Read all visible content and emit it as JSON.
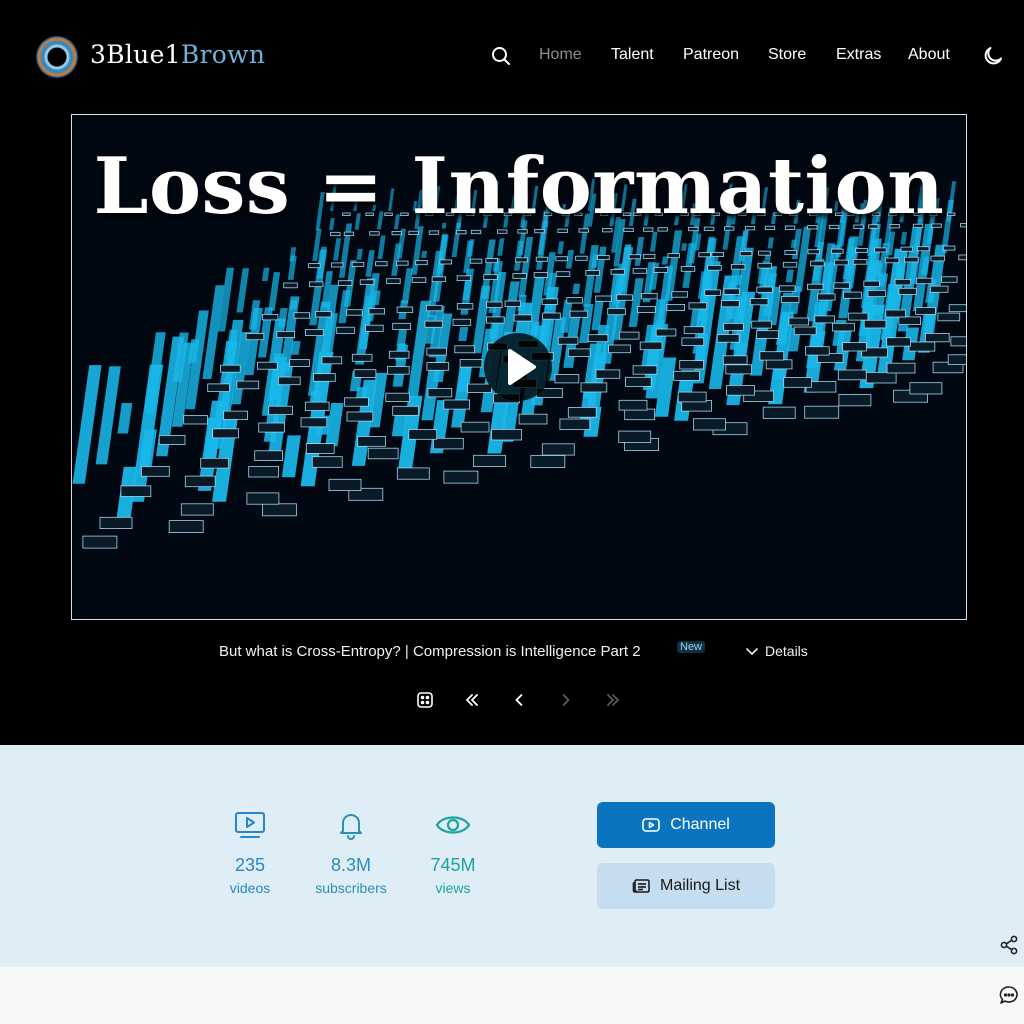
{
  "brand": {
    "name_part1": "3Blue1",
    "name_part2": "Brown"
  },
  "nav": {
    "search_icon": "search-icon",
    "items": [
      "Home",
      "Talent",
      "Patreon",
      "Store",
      "Extras",
      "About"
    ],
    "active": "Home",
    "theme_icon": "moon-icon"
  },
  "video": {
    "thumbnail_title": "Loss = Information",
    "title": "But what is Cross-Entropy? | Compression is Intelligence Part 2",
    "badge": "New",
    "details_label": "Details"
  },
  "controls": [
    "shuffle-icon",
    "first-icon",
    "previous-icon",
    "next-icon",
    "last-icon"
  ],
  "stats": [
    {
      "value": "235",
      "label": "videos",
      "icon": "video-icon",
      "color": "#2a86c8"
    },
    {
      "value": "8.3M",
      "label": "subscribers",
      "icon": "bell-icon",
      "color": "#2a8fb8"
    },
    {
      "value": "745M",
      "label": "views",
      "icon": "eye-icon",
      "color": "#1fa39a"
    }
  ],
  "buttons": {
    "channel": "Channel",
    "mailing_list": "Mailing List"
  },
  "colors": {
    "accent": "#0b74c0",
    "stats_bg": "#deedf6",
    "bar": "#19b8ea"
  }
}
